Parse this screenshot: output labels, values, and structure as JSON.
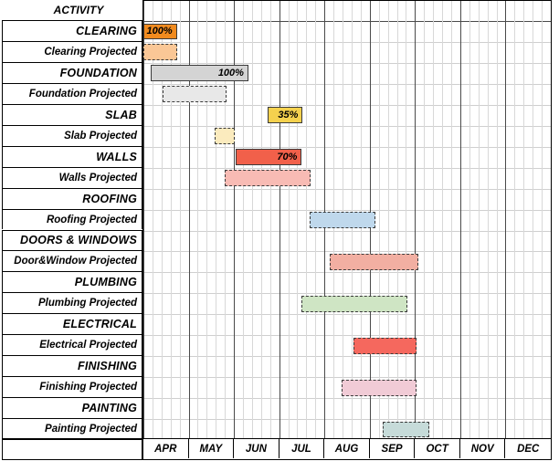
{
  "header": {
    "activity_label": "ACTIVITY"
  },
  "axis": {
    "months": [
      "APR",
      "MAY",
      "JUN",
      "JUL",
      "AUG",
      "SEP",
      "OCT",
      "NOV",
      "DEC"
    ],
    "start_month_index": 1,
    "total_slots": 9.0
  },
  "chart_data": {
    "type": "bar",
    "title": "Construction Project Gantt Chart",
    "xlabel": "",
    "ylabel": "ACTIVITY",
    "orientation": "horizontal",
    "categories": [
      "CLEARING",
      "Clearing Projected",
      "FOUNDATION",
      "Foundation Projected",
      "SLAB",
      "Slab Projected",
      "WALLS",
      "Walls Projected",
      "ROOFING",
      "Roofing Projected",
      "DOORS & WINDOWS",
      "Door&Window Projected",
      "PLUMBING",
      "Plumbing Projected",
      "ELECTRICAL",
      "Electrical Projected",
      "FINISHING",
      "Finishing Projected",
      "PAINTING",
      "Painting Projected"
    ],
    "x_axis_tick_labels": [
      "APR",
      "MAY",
      "JUN",
      "JUL",
      "AUG",
      "SEP",
      "OCT",
      "NOV",
      "DEC"
    ],
    "grid": true,
    "legend": "none",
    "rows": [
      {
        "label": "CLEARING",
        "kind": "major",
        "bar": {
          "start": 0.0,
          "end": 0.74,
          "fill": "#F18B1F",
          "border": "#3a3a3a",
          "style": "solid",
          "pct": "100%"
        }
      },
      {
        "label": "Clearing Projected",
        "kind": "minor",
        "bar": {
          "start": 0.0,
          "end": 0.74,
          "fill": "#FAC796",
          "border": "#3a3a3a",
          "style": "dashed",
          "pct": ""
        }
      },
      {
        "label": "FOUNDATION",
        "kind": "major",
        "bar": {
          "start": 0.17,
          "end": 2.32,
          "fill": "#D4D4D4",
          "border": "#3a3a3a",
          "style": "solid",
          "pct": "100%"
        }
      },
      {
        "label": "Foundation Projected",
        "kind": "minor",
        "bar": {
          "start": 0.42,
          "end": 1.84,
          "fill": "#E8E8E8",
          "border": "#3a3a3a",
          "style": "dashed",
          "pct": ""
        }
      },
      {
        "label": "SLAB",
        "kind": "major",
        "bar": {
          "start": 2.74,
          "end": 3.52,
          "fill": "#F5D14E",
          "border": "#3a3a3a",
          "style": "solid",
          "pct": "35%"
        }
      },
      {
        "label": "Slab Projected",
        "kind": "minor",
        "bar": {
          "start": 1.58,
          "end": 2.02,
          "fill": "#FBEBBE",
          "border": "#3a3a3a",
          "style": "dashed",
          "pct": ""
        }
      },
      {
        "label": "WALLS",
        "kind": "major",
        "bar": {
          "start": 2.04,
          "end": 3.5,
          "fill": "#F1604A",
          "border": "#3a3a3a",
          "style": "solid",
          "pct": "70%"
        }
      },
      {
        "label": "Walls Projected",
        "kind": "minor",
        "bar": {
          "start": 1.8,
          "end": 3.7,
          "fill": "#F8BBB4",
          "border": "#3a3a3a",
          "style": "dashed",
          "pct": ""
        }
      },
      {
        "label": "ROOFING",
        "kind": "major",
        "bar": null
      },
      {
        "label": "Roofing Projected",
        "kind": "minor",
        "bar": {
          "start": 3.68,
          "end": 5.12,
          "fill": "#BFD8EC",
          "border": "#3a3a3a",
          "style": "dashed",
          "pct": ""
        }
      },
      {
        "label": "DOORS & WINDOWS",
        "kind": "major",
        "bar": null
      },
      {
        "label": "Door&Window Projected",
        "kind": "minor",
        "bar": {
          "start": 4.12,
          "end": 6.08,
          "fill": "#F2AFA2",
          "border": "#3a3a3a",
          "style": "dashed",
          "pct": ""
        }
      },
      {
        "label": "PLUMBING",
        "kind": "major",
        "bar": null
      },
      {
        "label": "Plumbing Projected",
        "kind": "minor",
        "bar": {
          "start": 3.5,
          "end": 5.84,
          "fill": "#CFE5C4",
          "border": "#3a3a3a",
          "style": "dashed",
          "pct": ""
        }
      },
      {
        "label": "ELECTRICAL",
        "kind": "major",
        "bar": null
      },
      {
        "label": "Electrical Projected",
        "kind": "minor",
        "bar": {
          "start": 4.64,
          "end": 6.04,
          "fill": "#F5685E",
          "border": "#3a3a3a",
          "style": "dashed",
          "pct": ""
        }
      },
      {
        "label": "FINISHING",
        "kind": "major",
        "bar": null
      },
      {
        "label": "Finishing Projected",
        "kind": "minor",
        "bar": {
          "start": 4.38,
          "end": 6.04,
          "fill": "#F1CBD6",
          "border": "#3a3a3a",
          "style": "dashed",
          "pct": ""
        }
      },
      {
        "label": "PAINTING",
        "kind": "major",
        "bar": null
      },
      {
        "label": "Painting Projected",
        "kind": "minor",
        "bar": {
          "start": 5.28,
          "end": 6.32,
          "fill": "#C6DBD9",
          "border": "#3a3a3a",
          "style": "dashed",
          "pct": ""
        }
      }
    ],
    "progress_labels": [
      {
        "activity": "CLEARING",
        "value": "100%"
      },
      {
        "activity": "FOUNDATION",
        "value": "100%"
      },
      {
        "activity": "SLAB",
        "value": "35%"
      },
      {
        "activity": "WALLS",
        "value": "70%"
      }
    ],
    "colors": {
      "clearing": "#F18B1F",
      "clearing_projected": "#FAC796",
      "foundation": "#D4D4D4",
      "foundation_projected": "#E8E8E8",
      "slab": "#F5D14E",
      "slab_projected": "#FBEBBE",
      "walls": "#F1604A",
      "walls_projected": "#F8BBB4",
      "roofing_projected": "#BFD8EC",
      "doorwindow_projected": "#F2AFA2",
      "plumbing_projected": "#CFE5C4",
      "electrical_projected": "#F5685E",
      "finishing_projected": "#F1CBD6",
      "painting_projected": "#C6DBD9",
      "grid_week": "#d8d8d8",
      "grid_month": "#4a4a4a",
      "border": "#000000"
    }
  }
}
